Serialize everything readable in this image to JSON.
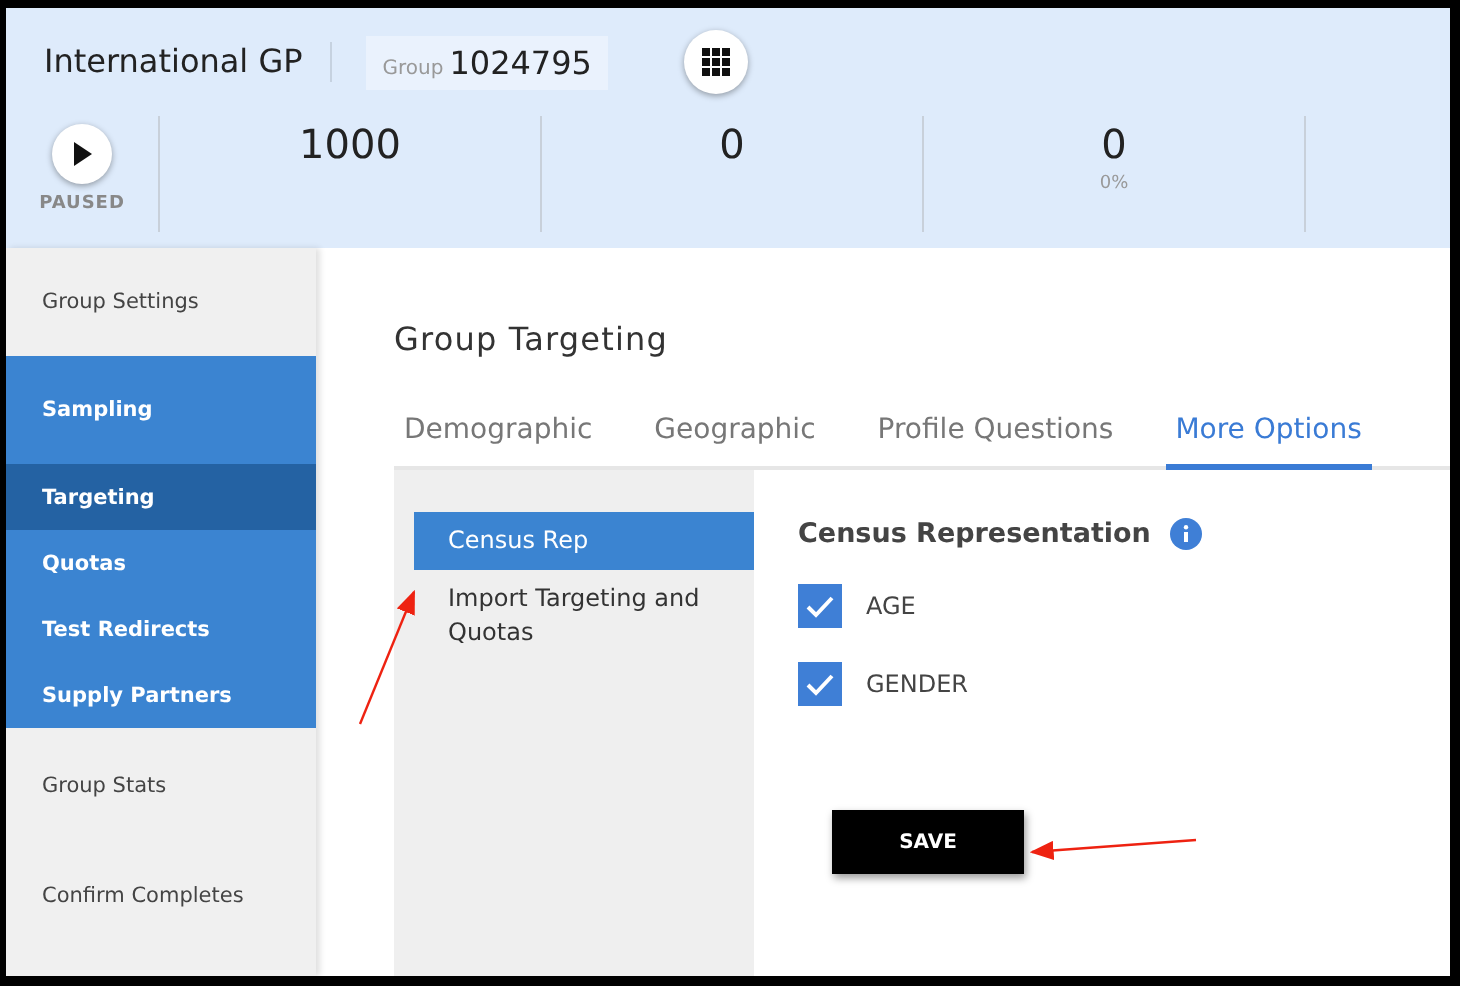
{
  "header": {
    "title": "International GP",
    "group_label": "Group",
    "group_id": "1024795",
    "status": "PAUSED",
    "stats": [
      {
        "value": "1000"
      },
      {
        "value": "0"
      },
      {
        "value": "0",
        "sub": "0%"
      }
    ]
  },
  "sidebar": {
    "items": [
      {
        "label": "Group Settings",
        "kind": "link"
      },
      {
        "label": "Sampling",
        "kind": "section",
        "children": [
          {
            "label": "Targeting",
            "selected": true
          },
          {
            "label": "Quotas",
            "selected": false
          },
          {
            "label": "Test Redirects",
            "selected": false
          },
          {
            "label": "Supply Partners",
            "selected": false
          }
        ]
      },
      {
        "label": "Group Stats",
        "kind": "link"
      },
      {
        "label": "Confirm Completes",
        "kind": "link"
      }
    ]
  },
  "page_title": "Group Targeting",
  "tabs": [
    {
      "label": "Demographic",
      "selected": false
    },
    {
      "label": "Geographic",
      "selected": false
    },
    {
      "label": "Profile Questions",
      "selected": false
    },
    {
      "label": "More Options",
      "selected": true
    }
  ],
  "subnav": [
    {
      "label": "Census Rep",
      "selected": true
    },
    {
      "label": "Import Targeting and Quotas",
      "selected": false
    }
  ],
  "panel": {
    "title": "Census Representation",
    "options": [
      {
        "label": "AGE",
        "checked": true
      },
      {
        "label": "GENDER",
        "checked": true
      }
    ],
    "save": "SAVE"
  }
}
